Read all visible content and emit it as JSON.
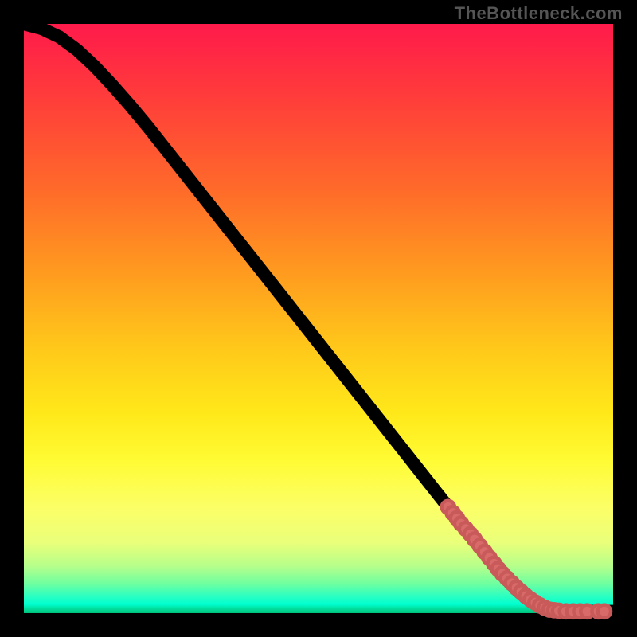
{
  "watermark": "TheBottleneck.com",
  "colors": {
    "background": "#000000",
    "curve": "#000000",
    "dot_fill": "#d96a6a",
    "dot_stroke": "#c95a5a"
  },
  "chart_data": {
    "type": "line",
    "title": "",
    "xlabel": "",
    "ylabel": "",
    "xlim": [
      0,
      100
    ],
    "ylim": [
      0,
      100
    ],
    "grid": false,
    "legend": null,
    "series": [
      {
        "name": "curve",
        "x": [
          0,
          3,
          6,
          9,
          12,
          15,
          18,
          21,
          24,
          27,
          30,
          33,
          36,
          39,
          42,
          45,
          48,
          51,
          54,
          57,
          60,
          63,
          66,
          69,
          72,
          75,
          78,
          80,
          82,
          84,
          86,
          88,
          90,
          92,
          94,
          96,
          98,
          100
        ],
        "y": [
          100,
          99.2,
          97.8,
          95.6,
          92.8,
          89.6,
          86.2,
          82.6,
          78.8,
          75.0,
          71.2,
          67.4,
          63.6,
          59.8,
          56.0,
          52.2,
          48.4,
          44.6,
          40.8,
          37.0,
          33.2,
          29.4,
          25.6,
          21.8,
          18.0,
          14.2,
          10.4,
          7.9,
          5.6,
          3.6,
          2.0,
          1.0,
          0.5,
          0.3,
          0.3,
          0.3,
          0.3,
          0.3
        ]
      }
    ],
    "scatter_points": {
      "name": "highlight-dots",
      "x": [
        72.0,
        72.8,
        73.5,
        74.2,
        75.0,
        75.8,
        76.5,
        77.4,
        78.2,
        79.0,
        79.8,
        80.5,
        81.2,
        82.0,
        82.8,
        83.6,
        84.4,
        85.2,
        86.0,
        86.8,
        87.6,
        88.4,
        89.2,
        90.0,
        90.8,
        92.0,
        93.2,
        94.4,
        95.6,
        97.5,
        98.5
      ],
      "y": [
        18.0,
        17.0,
        16.1,
        15.2,
        14.3,
        13.4,
        12.5,
        11.4,
        10.4,
        9.4,
        8.4,
        7.5,
        6.7,
        5.9,
        5.1,
        4.3,
        3.6,
        2.9,
        2.3,
        1.8,
        1.3,
        0.9,
        0.6,
        0.5,
        0.4,
        0.3,
        0.3,
        0.3,
        0.3,
        0.3,
        0.3
      ]
    }
  }
}
